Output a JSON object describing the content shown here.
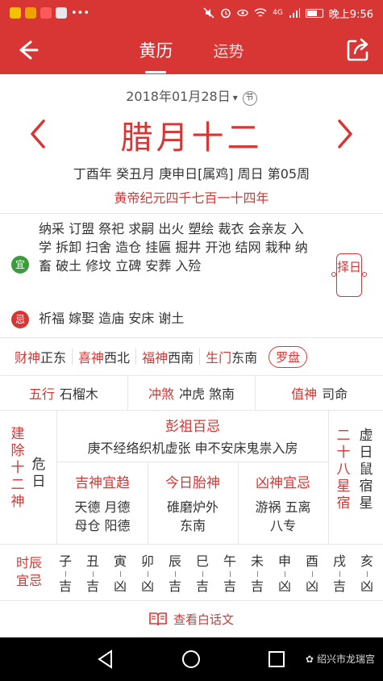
{
  "status": {
    "time": "晚上9:56",
    "network": "4G"
  },
  "header": {
    "tabs": [
      {
        "label": "黄历"
      },
      {
        "label": "运势"
      }
    ]
  },
  "date": {
    "solar": "2018年01月28日",
    "festival_icon": "节",
    "lunar": "腊月十二",
    "ganzhi": "丁酉年 癸丑月 庚申日[属鸡] 周日 第05周",
    "era": "黄帝纪元四千七百一十四年"
  },
  "yi": {
    "badge": "宜",
    "text": "纳采 订盟 祭祀 求嗣 出火 塑绘 裁衣 会亲友 入学 拆卸 扫舍 造仓 挂匾 掘井 开池 结网 栽种 纳畜 破土 修坟 立碑 安葬 入殓"
  },
  "ji": {
    "badge": "忌",
    "text": "祈福 嫁娶 造庙 安床 谢土"
  },
  "zeri_label": "择日",
  "shen": [
    {
      "label": "财神",
      "value": "正东"
    },
    {
      "label": "喜神",
      "value": "西北"
    },
    {
      "label": "福神",
      "value": "西南"
    },
    {
      "label": "生门",
      "value": "东南"
    }
  ],
  "luopan_label": "罗盘",
  "wuxing": {
    "label": "五行",
    "value": "石榴木"
  },
  "chongsha": {
    "label": "冲煞",
    "value": "冲虎 煞南"
  },
  "zhishen": {
    "label": "值神",
    "value": "司命"
  },
  "jianchu": {
    "label": "建除十二神",
    "value": "危日"
  },
  "pengzu": {
    "title": "彭祖百忌",
    "text": "庚不经络织机虚张 申不安床鬼祟入房"
  },
  "jishen": {
    "title": "吉神宜趋",
    "lines": [
      "天德 月德",
      "母仓 阳德"
    ]
  },
  "taishen": {
    "title": "今日胎神",
    "lines": [
      "碓磨炉外",
      "东南"
    ]
  },
  "xiongshen": {
    "title": "凶神宜忌",
    "lines": [
      "游祸 五离",
      "八专"
    ]
  },
  "xiu": {
    "label": "二十八星宿",
    "value": "虚日鼠宿星"
  },
  "hours_label": "时辰宜忌",
  "hours": [
    {
      "zhi": "子",
      "luck": "吉"
    },
    {
      "zhi": "丑",
      "luck": "吉"
    },
    {
      "zhi": "寅",
      "luck": "凶"
    },
    {
      "zhi": "卯",
      "luck": "凶"
    },
    {
      "zhi": "辰",
      "luck": "吉"
    },
    {
      "zhi": "巳",
      "luck": "吉"
    },
    {
      "zhi": "午",
      "luck": "吉"
    },
    {
      "zhi": "未",
      "luck": "吉"
    },
    {
      "zhi": "申",
      "luck": "凶"
    },
    {
      "zhi": "酉",
      "luck": "凶"
    },
    {
      "zhi": "戌",
      "luck": "吉"
    },
    {
      "zhi": "亥",
      "luck": "凶"
    }
  ],
  "bottom_link": "查看白话文",
  "watermark": "绍兴市龙瑞宫",
  "colors": {
    "accent": "#d73634",
    "yi_badge": "#3c9b3c",
    "text": "#333333"
  }
}
